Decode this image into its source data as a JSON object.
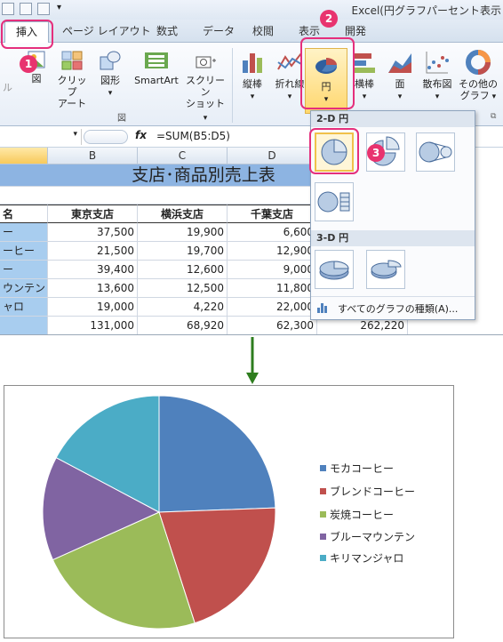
{
  "window": {
    "title": "Excel(円グラフパーセント表示"
  },
  "tabs": [
    "挿入",
    "ページ レイアウト",
    "数式",
    "データ",
    "校閲",
    "表示",
    "開発"
  ],
  "ribbon": {
    "picture": "図",
    "clipart_1": "クリップ",
    "clipart_2": "アート",
    "shapes": "図形",
    "smartart": "SmartArt",
    "screenshot_1": "スクリーン",
    "screenshot_2": "ショット",
    "group_illust": "図",
    "column": "縦棒",
    "line": "折れ線",
    "pie": "円",
    "bar": "横棒",
    "area": "面",
    "scatter": "散布図",
    "other_1": "その他の",
    "other_2": "グラフ",
    "left_partial": "ル"
  },
  "formula": {
    "fx": "fx",
    "text": "=SUM(B5:D5)"
  },
  "sheet": {
    "columns": [
      "B",
      "C",
      "D"
    ],
    "title": "支店･商品別売上表",
    "headers": [
      "名",
      "東京支店",
      "横浜支店",
      "千葉支店"
    ],
    "rows": [
      {
        "name": "ー",
        "b": "37,500",
        "c": "19,900",
        "d": "6,600"
      },
      {
        "name": "ーヒー",
        "b": "21,500",
        "c": "19,700",
        "d": "12,900"
      },
      {
        "name": "ー",
        "b": "39,400",
        "c": "12,600",
        "d": "9,000"
      },
      {
        "name": "ウンテン",
        "b": "13,600",
        "c": "12,500",
        "d": "11,800"
      },
      {
        "name": "ャロ",
        "b": "19,000",
        "c": "4,220",
        "d": "22,000"
      }
    ],
    "totals": {
      "b": "131,000",
      "c": "68,920",
      "d": "62,300",
      "e": "262,220"
    }
  },
  "menu": {
    "section_2d": "2-D 円",
    "section_3d": "3-D 円",
    "all_charts": "すべてのグラフの種類(A)..."
  },
  "badges": [
    "1",
    "2",
    "3"
  ],
  "colors": {
    "highlight": "#e52f7c",
    "arrow": "#2e7d1e"
  },
  "chart_data": {
    "type": "pie",
    "categories": [
      "モカコーヒー",
      "ブレンドコーヒー",
      "炭焼コーヒー",
      "ブルーマウンテン",
      "キリマンジャロ"
    ],
    "values": [
      64000,
      54100,
      61000,
      37900,
      45220
    ],
    "colors": [
      "#4f81bd",
      "#c0504d",
      "#9bbb59",
      "#8064a2",
      "#4bacc6"
    ],
    "legend": "right"
  }
}
